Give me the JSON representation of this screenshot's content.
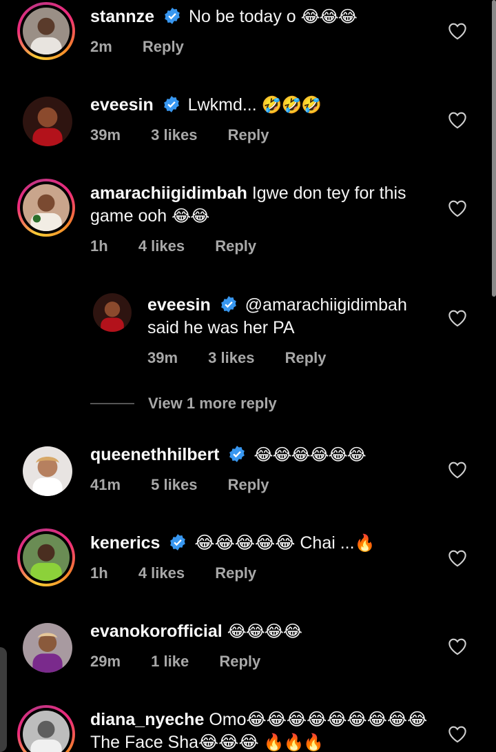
{
  "comments": [
    {
      "username": "stannze",
      "verified": true,
      "text": "No be today o",
      "emoji": "😂😂😂",
      "time": "2m",
      "likes": "",
      "reply_label": "Reply"
    },
    {
      "username": "eveesin",
      "verified": true,
      "text": "Lwkmd...",
      "emoji": "🤣🤣🤣",
      "time": "39m",
      "likes": "3 likes",
      "reply_label": "Reply"
    },
    {
      "username": "amarachiigidimbah",
      "verified": false,
      "text": "Igwe don tey for this game ooh",
      "emoji": "😂😂",
      "time": "1h",
      "likes": "4 likes",
      "reply_label": "Reply"
    },
    {
      "username": "eveesin",
      "verified": true,
      "text": "@amarachiigidimbah said he was her PA",
      "emoji": "",
      "time": "39m",
      "likes": "3 likes",
      "reply_label": "Reply"
    },
    {
      "username": "queenethhilbert",
      "verified": true,
      "text": "",
      "emoji": "😂😂😂😂😂😂",
      "time": "41m",
      "likes": "5 likes",
      "reply_label": "Reply"
    },
    {
      "username": "kenerics",
      "verified": true,
      "text": "😂😂😂😂😂 Chai ...",
      "emoji": "🔥",
      "time": "1h",
      "likes": "4 likes",
      "reply_label": "Reply"
    },
    {
      "username": "evanokorofficial",
      "verified": false,
      "text": "",
      "emoji": "😂😂😂😂",
      "time": "29m",
      "likes": "1 like",
      "reply_label": "Reply"
    },
    {
      "username": "diana_nyeche",
      "verified": false,
      "text": "Omo😂😂😂😂😂😂😂😂😂 The Face Sha😂😂😂",
      "emoji": "🔥🔥🔥",
      "time": "",
      "likes": "",
      "reply_label": ""
    }
  ],
  "view_more_replies": "View 1 more reply",
  "colors": {
    "background": "#000000",
    "meta": "#a8a8a8",
    "verified_badge": "#3897f0"
  },
  "icons": [
    "verified-badge-icon",
    "heart-icon"
  ]
}
